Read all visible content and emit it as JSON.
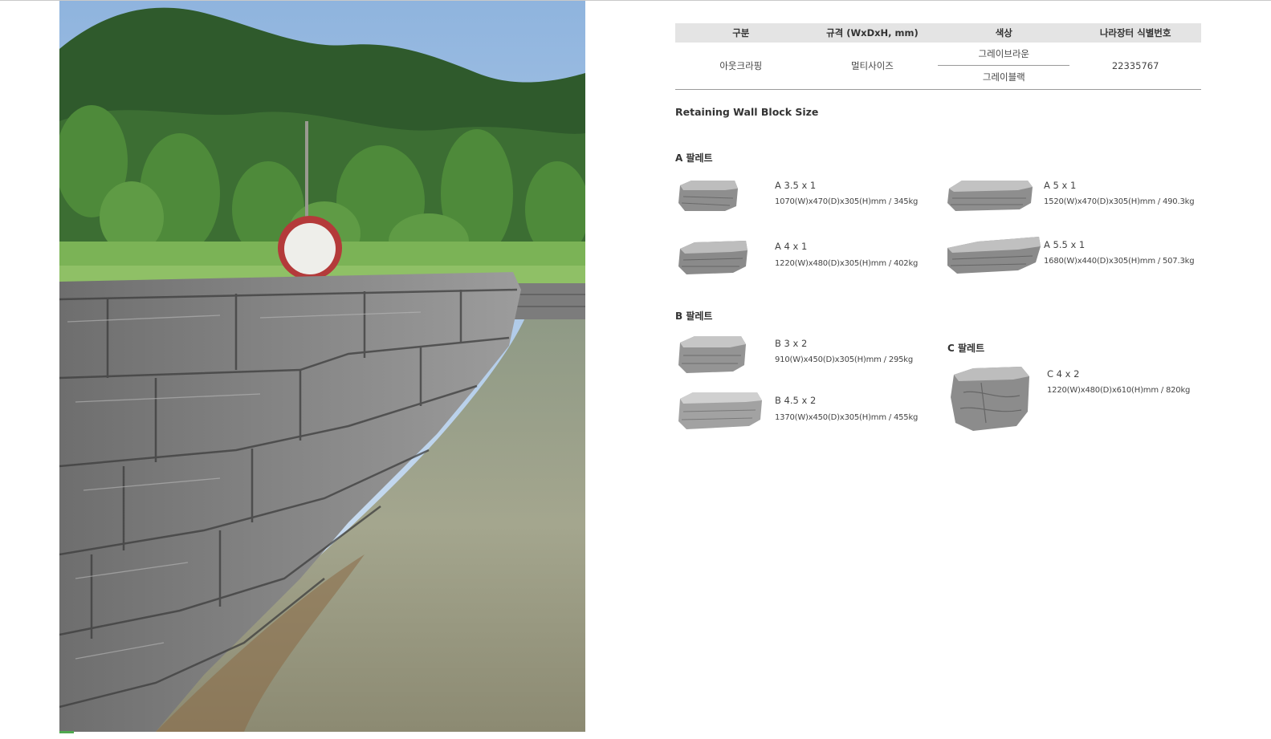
{
  "table": {
    "headers": [
      "구분",
      "규격 (WxDxH, mm)",
      "색상",
      "나라장터 식별번호"
    ],
    "row": {
      "category": "아웃크라핑",
      "spec": "멀티사이즈",
      "colors": [
        "그레이브라운",
        "그레이블랙"
      ],
      "id_number": "22335767"
    }
  },
  "section_title": "Retaining Wall Block Size",
  "pallets": {
    "a": {
      "label": "A 팔레트",
      "blocks": [
        {
          "name": "A 3.5 x 1",
          "dims": "1070(W)x470(D)x305(H)mm / 345kg"
        },
        {
          "name": "A 5 x 1",
          "dims": "1520(W)x470(D)x305(H)mm / 490.3kg"
        },
        {
          "name": "A 4 x 1",
          "dims": "1220(W)x480(D)x305(H)mm / 402kg"
        },
        {
          "name": "A 5.5 x 1",
          "dims": "1680(W)x440(D)x305(H)mm / 507.3kg"
        }
      ]
    },
    "b": {
      "label": "B 팔레트",
      "blocks": [
        {
          "name": "B 3 x 2",
          "dims": "910(W)x450(D)x305(H)mm / 295kg"
        },
        {
          "name": "B 4.5 x 2",
          "dims": "1370(W)x450(D)x305(H)mm / 455kg"
        }
      ]
    },
    "c": {
      "label": "C 팔레트",
      "blocks": [
        {
          "name": "C 4 x 2",
          "dims": "1220(W)x480(D)x610(H)mm / 820kg"
        }
      ]
    }
  },
  "colors": {
    "header_bg": "#e4e4e4",
    "rule": "#9a9a9a",
    "stone_light": "#b5b5b5",
    "stone_dark": "#7d7d7d"
  }
}
